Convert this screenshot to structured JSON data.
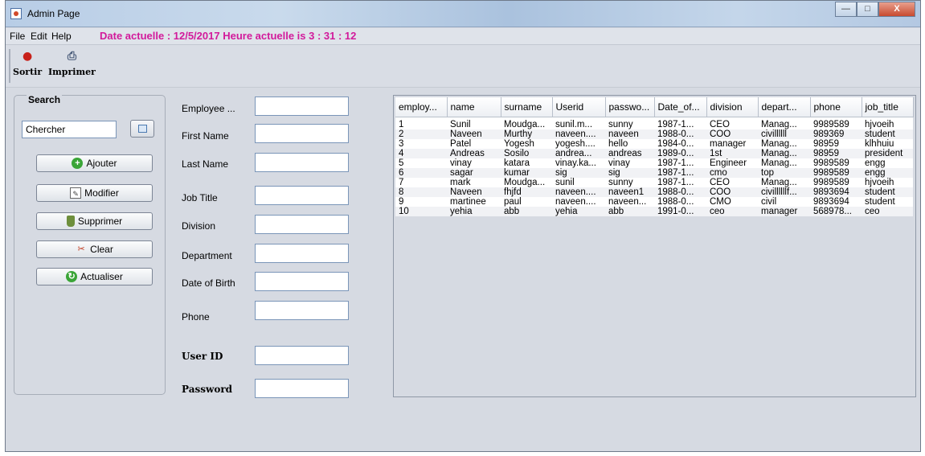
{
  "window": {
    "title": "Admin Page"
  },
  "menu": {
    "items": [
      "File",
      "Edit",
      "Help"
    ],
    "datetime": "Date actuelle : 12/5/2017  Heure actuelle is  3 : 31 : 12"
  },
  "toolbar": {
    "exit_label": "Sortir",
    "print_label": "Imprimer"
  },
  "search": {
    "title": "Search",
    "input_value": "Chercher",
    "buttons": {
      "add": "Ajouter",
      "modify": "Modifier",
      "delete": "Supprimer",
      "clear": "Clear",
      "refresh": "Actualiser"
    }
  },
  "form": {
    "employee_id": "Employee ...",
    "first_name": "First Name",
    "last_name": "Last Name",
    "job_title": "Job Title",
    "division": "Division",
    "department": "Department",
    "dob": "Date of Birth",
    "phone": "Phone",
    "user_id": "User ID",
    "password": "Password"
  },
  "table": {
    "columns": [
      "employ...",
      "name",
      "surname",
      "Userid",
      "passwo...",
      "Date_of...",
      "division",
      "depart...",
      "phone",
      "job_title"
    ],
    "rows": [
      [
        "1",
        "Sunil",
        "Moudga...",
        "sunil.m...",
        "sunny",
        "1987-1...",
        "CEO",
        "Manag...",
        "9989589",
        "hjvoeih"
      ],
      [
        "2",
        "Naveen",
        "Murthy",
        "naveen....",
        "naveen",
        "1988-0...",
        "COO",
        "civillllll",
        "989369",
        "student"
      ],
      [
        "3",
        "Patel",
        "Yogesh",
        "yogesh....",
        "hello",
        "1984-0...",
        "manager",
        "Manag...",
        "98959",
        "klhhuiu"
      ],
      [
        "4",
        "Andreas",
        "Sosilo",
        "andrea...",
        "andreas",
        "1989-0...",
        "1st",
        "Manag...",
        "98959",
        "president"
      ],
      [
        "5",
        "vinay",
        "katara",
        "vinay.ka...",
        "vinay",
        "1987-1...",
        "Engineer",
        "Manag...",
        "9989589",
        "engg"
      ],
      [
        "6",
        "sagar",
        "kumar",
        "sig",
        "sig",
        "1987-1...",
        "cmo",
        "top",
        "9989589",
        "engg"
      ],
      [
        "7",
        "mark",
        "Moudga...",
        "sunil",
        "sunny",
        "1987-1...",
        "CEO",
        "Manag...",
        "9989589",
        "hjvoeih"
      ],
      [
        "8",
        "Naveen",
        "fhjfd",
        "naveen....",
        "naveen1",
        "1988-0...",
        "COO",
        "civillllllf...",
        "9893694",
        "student"
      ],
      [
        "9",
        "martinee",
        "paul",
        "naveen....",
        "naveen...",
        "1988-0...",
        "CMO",
        "civil",
        "9893694",
        "student"
      ],
      [
        "10",
        "yehia",
        "abb",
        "yehia",
        "abb",
        "1991-0...",
        "ceo",
        "manager",
        "568978...",
        "ceo"
      ]
    ]
  },
  "colors": {
    "accent_datetime": "#d21a9b",
    "window_bg": "#d6dae2"
  }
}
